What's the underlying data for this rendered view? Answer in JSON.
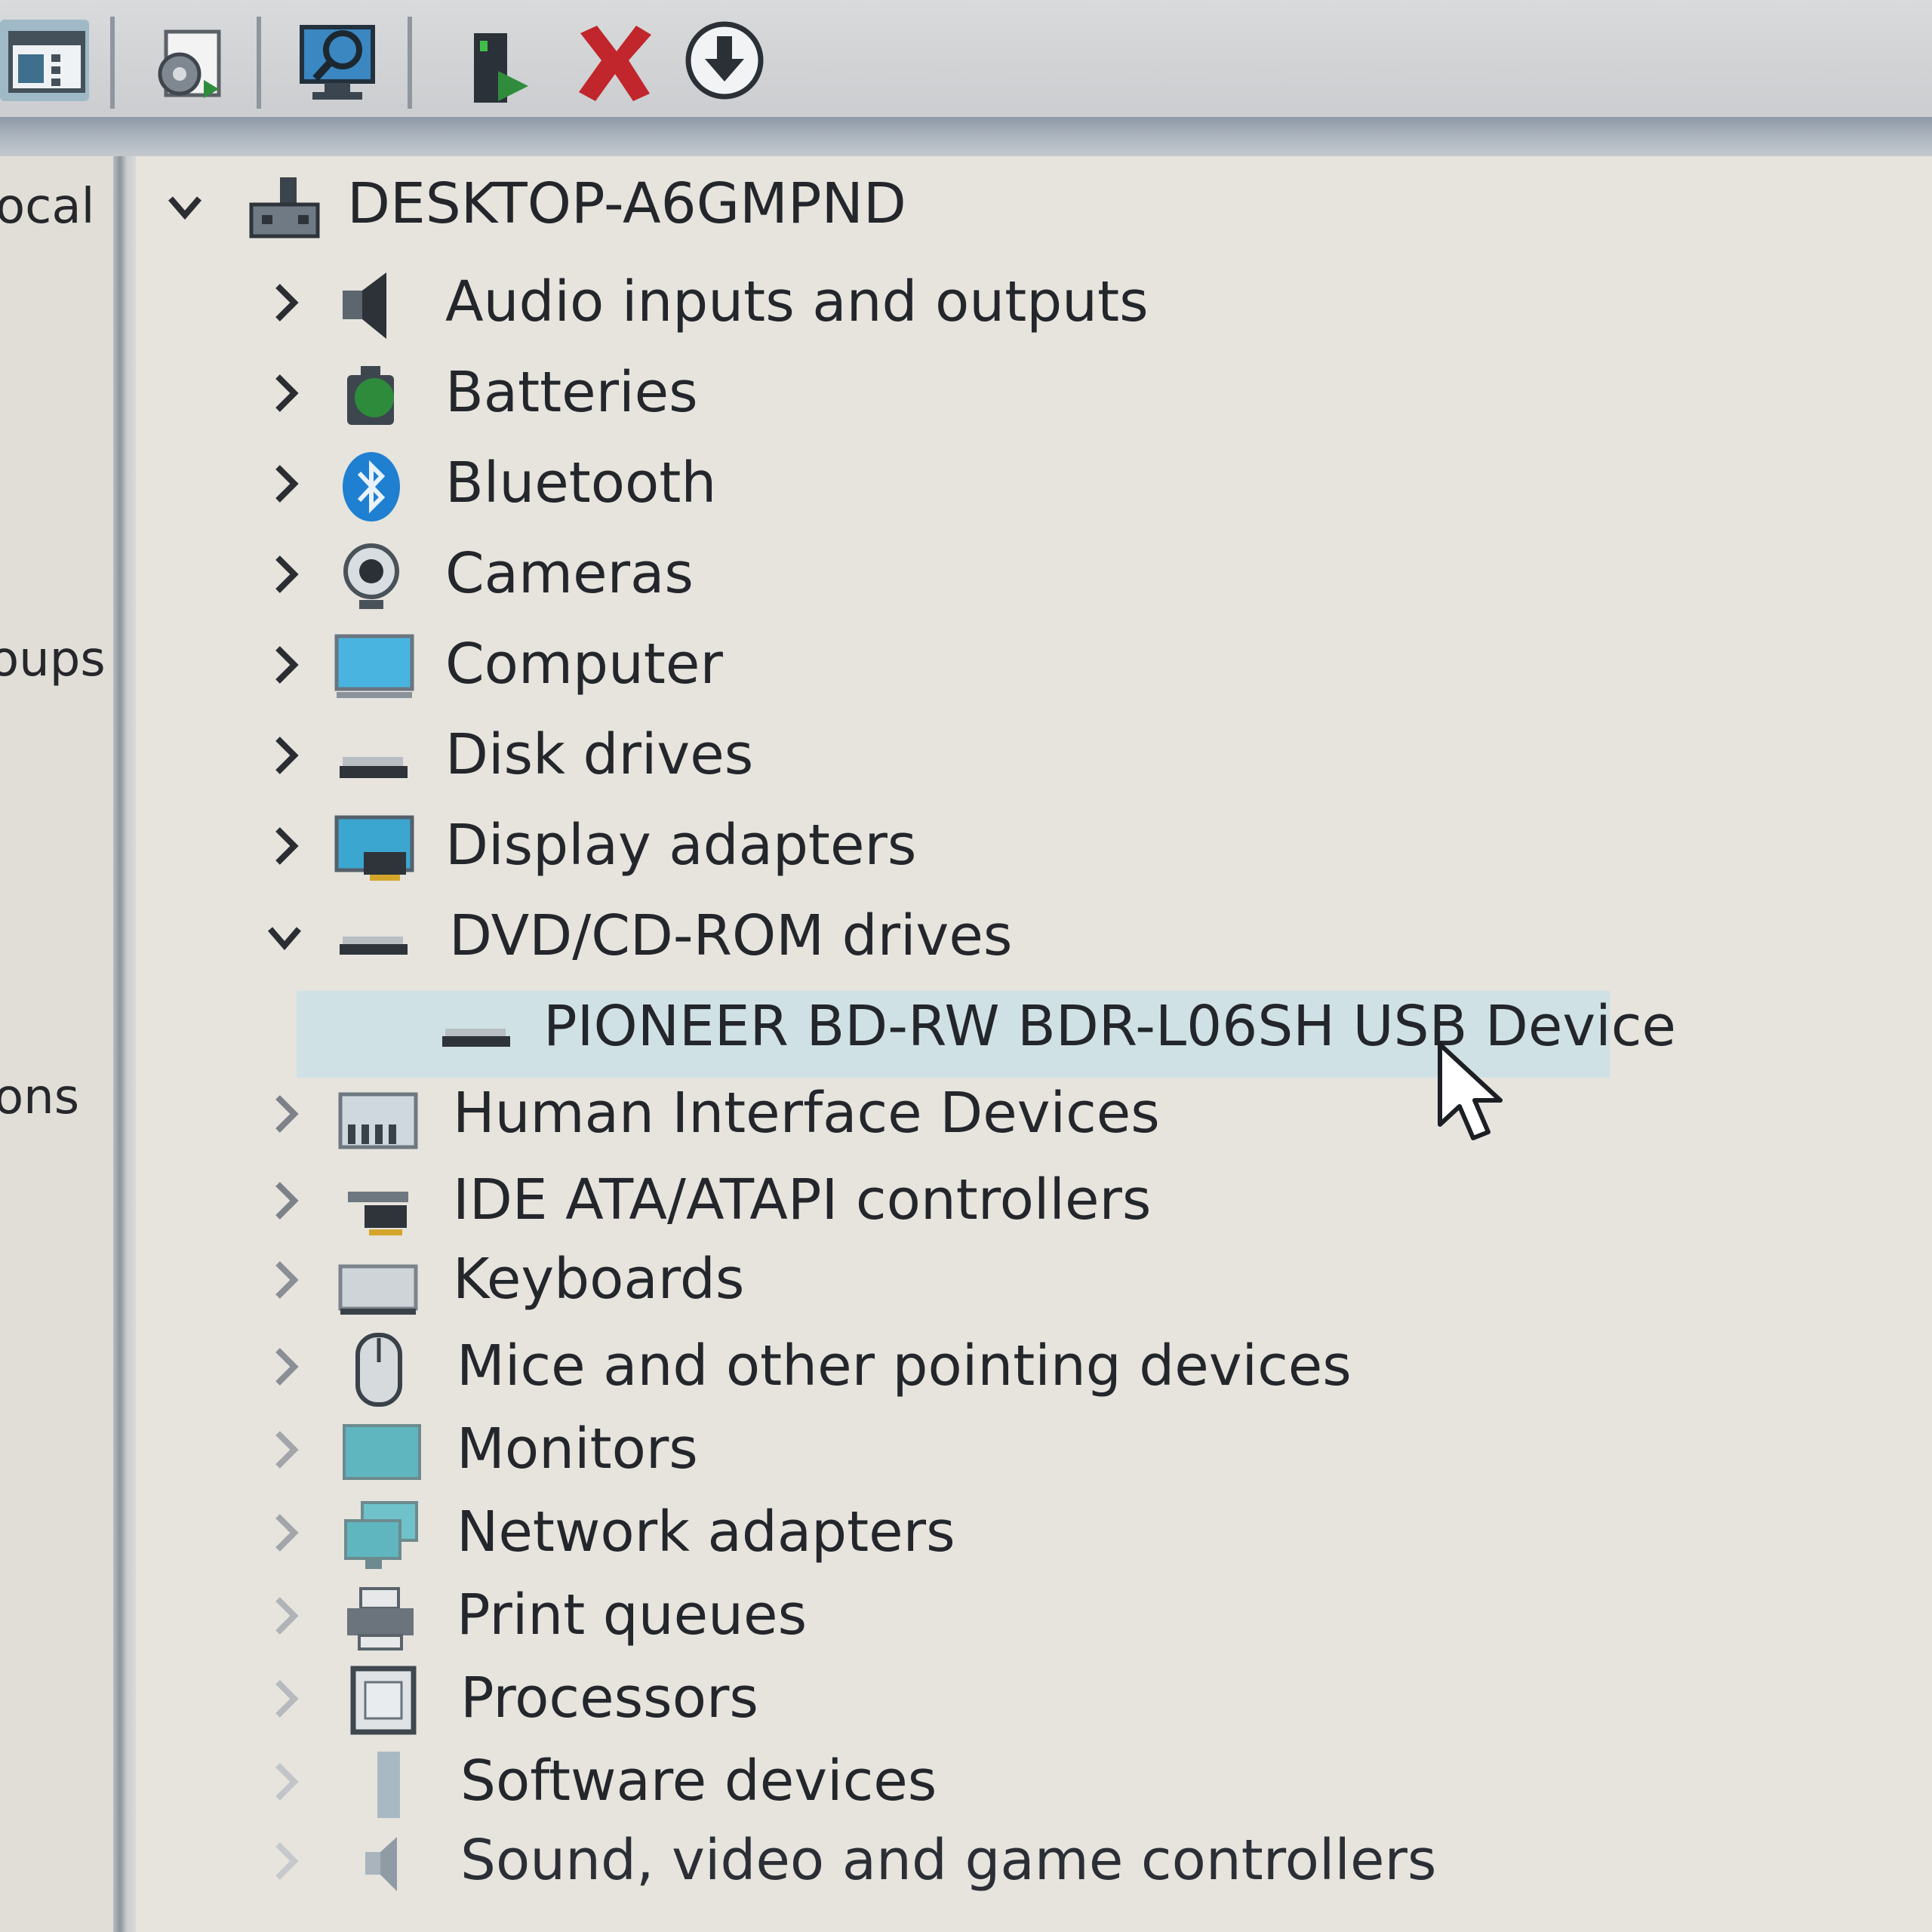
{
  "toolbar": {
    "buttons": [
      {
        "name": "show-hide-console-tree-icon"
      },
      {
        "name": "properties-icon"
      },
      {
        "name": "scan-hardware-changes-icon"
      },
      {
        "name": "update-driver-icon"
      },
      {
        "name": "uninstall-device-icon"
      },
      {
        "name": "download-driver-icon"
      }
    ]
  },
  "left_pane": {
    "fragments": [
      "ocal",
      "oups",
      "ons"
    ]
  },
  "tree": {
    "root": {
      "label": "DESKTOP-A6GMPND",
      "expanded": true
    },
    "categories": [
      {
        "label": "Audio inputs and outputs",
        "icon": "speaker-icon"
      },
      {
        "label": "Batteries",
        "icon": "battery-icon"
      },
      {
        "label": "Bluetooth",
        "icon": "bluetooth-icon"
      },
      {
        "label": "Cameras",
        "icon": "camera-icon"
      },
      {
        "label": "Computer",
        "icon": "computer-icon"
      },
      {
        "label": "Disk drives",
        "icon": "disk-drive-icon"
      },
      {
        "label": "Display adapters",
        "icon": "display-adapter-icon"
      },
      {
        "label": "DVD/CD-ROM drives",
        "icon": "optical-drive-icon",
        "expanded": true
      },
      {
        "label": "PIONEER BD-RW BDR-L06SH USB Device",
        "icon": "optical-drive-icon",
        "child": true,
        "selected": true
      },
      {
        "label": "Human Interface Devices",
        "icon": "hid-icon"
      },
      {
        "label": "IDE ATA/ATAPI controllers",
        "icon": "ide-controller-icon"
      },
      {
        "label": "Keyboards",
        "icon": "keyboard-icon"
      },
      {
        "label": "Mice and other pointing devices",
        "icon": "mouse-icon"
      },
      {
        "label": "Monitors",
        "icon": "monitor-icon"
      },
      {
        "label": "Network adapters",
        "icon": "network-adapter-icon"
      },
      {
        "label": "Print queues",
        "icon": "printer-icon"
      },
      {
        "label": "Processors",
        "icon": "processor-icon"
      },
      {
        "label": "Software devices",
        "icon": "software-device-icon"
      },
      {
        "label": "Sound, video and game controllers",
        "icon": "sound-controller-icon"
      }
    ]
  },
  "colors": {
    "selection": "#cfe1e5",
    "background": "#e6e4dd",
    "uninstall_red": "#c0262b"
  }
}
